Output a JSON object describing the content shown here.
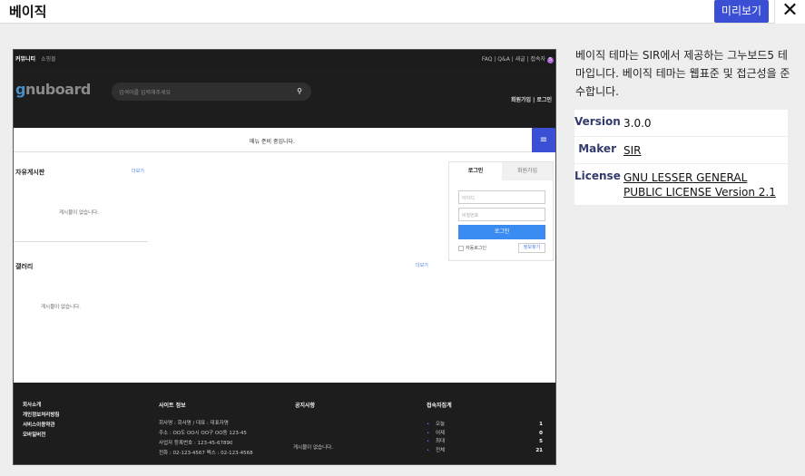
{
  "header": {
    "title": "베이직",
    "preview_label": "미리보기",
    "close_icon": "close-icon"
  },
  "theme": {
    "description": "베이직 테마는 SIR에서 제공하는 그누보드5 테마입니다. 베이직 테마는 웹표준 및 접근성을 준수합니다.",
    "fields": [
      {
        "label": "Version",
        "value": "3.0.0"
      },
      {
        "label": "Maker",
        "value": "SIR"
      },
      {
        "label": "License",
        "value": "GNU LESSER GENERAL PUBLIC LICENSE Version 2.1"
      }
    ]
  },
  "screenshot": {
    "topnav_left": "커뮤니티",
    "topnav_left2": "쇼핑몰",
    "topnav_right": "FAQ   |   Q&A   |   새글   |   접속자",
    "visitor_badge": "5",
    "logo": "gnuboard",
    "search_placeholder": "검색어를 입력해주세요",
    "header_links": "회원가입   |   로그인",
    "menu_msg": "메뉴 준비 중입니다.",
    "board_title": "자유게시판",
    "more": "더보기",
    "empty": "게시물이 없습니다.",
    "gallery_title": "갤러리",
    "login_tab": "로그인",
    "join_tab": "회원가입",
    "id_placeholder": "아이디",
    "pw_placeholder": "비밀번호",
    "login_button": "로그인",
    "auto_login": "자동로그인",
    "find_info": "정보찾기",
    "footer": {
      "links": [
        "회사소개",
        "개인정보처리방침",
        "서비스이용약관",
        "모바일버전"
      ],
      "site_info_title": "사이트 정보",
      "site_info": [
        "회사명 : 회사명 / 대표 : 대표자명",
        "주소 : OO도 OO시 OO구 OO동 123-45",
        "사업자 등록번호 : 123-45-67890",
        "전화 : 02-123-4567  팩스 : 02-123-4568"
      ],
      "notice_title": "공지사항",
      "notice_empty": "게시물이 없습니다.",
      "visitors_title": "접속자집계",
      "visitors": [
        {
          "label": "오늘",
          "value": "1"
        },
        {
          "label": "어제",
          "value": "0"
        },
        {
          "label": "최대",
          "value": "5"
        },
        {
          "label": "전체",
          "value": "21"
        }
      ]
    }
  }
}
